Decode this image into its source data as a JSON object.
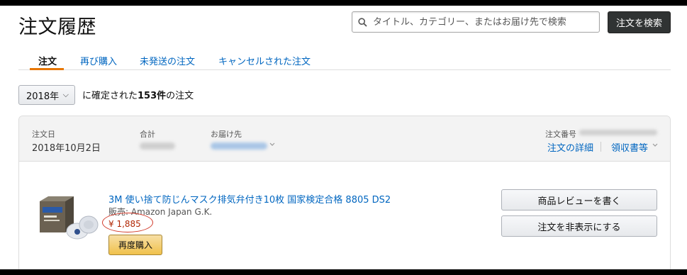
{
  "page_title": "注文履歴",
  "search": {
    "placeholder": "タイトル、カテゴリー、またはお届け先で検索",
    "button_label": "注文を検索"
  },
  "tabs": [
    {
      "label": "注文",
      "active": true
    },
    {
      "label": "再び購入",
      "active": false
    },
    {
      "label": "未発送の注文",
      "active": false
    },
    {
      "label": "キャンセルされた注文",
      "active": false
    }
  ],
  "filter": {
    "year_selected": "2018年",
    "count_prefix": "に確定された",
    "count": "153件",
    "count_suffix": "の注文"
  },
  "order": {
    "date_label": "注文日",
    "date_value": "2018年10月2日",
    "total_label": "合計",
    "ship_to_label": "お届け先",
    "order_number_label": "注文番号",
    "details_link": "注文の詳細",
    "receipt_link": "領収書等",
    "item": {
      "title": "3M 使い捨て防じんマスク排気弁付き10枚 国家検定合格 8805 DS2",
      "seller": "販売: Amazon Japan G.K.",
      "price": "¥ 1,885",
      "rebuy_label": "再度購入"
    },
    "actions": {
      "review_label": "商品レビューを書く",
      "hide_label": "注文を非表示にする"
    }
  },
  "colors": {
    "link": "#0066c0",
    "tab_accent": "#e77600",
    "price": "#b12704",
    "annotation_circle": "#d23a2a",
    "search_button": "#303333"
  }
}
